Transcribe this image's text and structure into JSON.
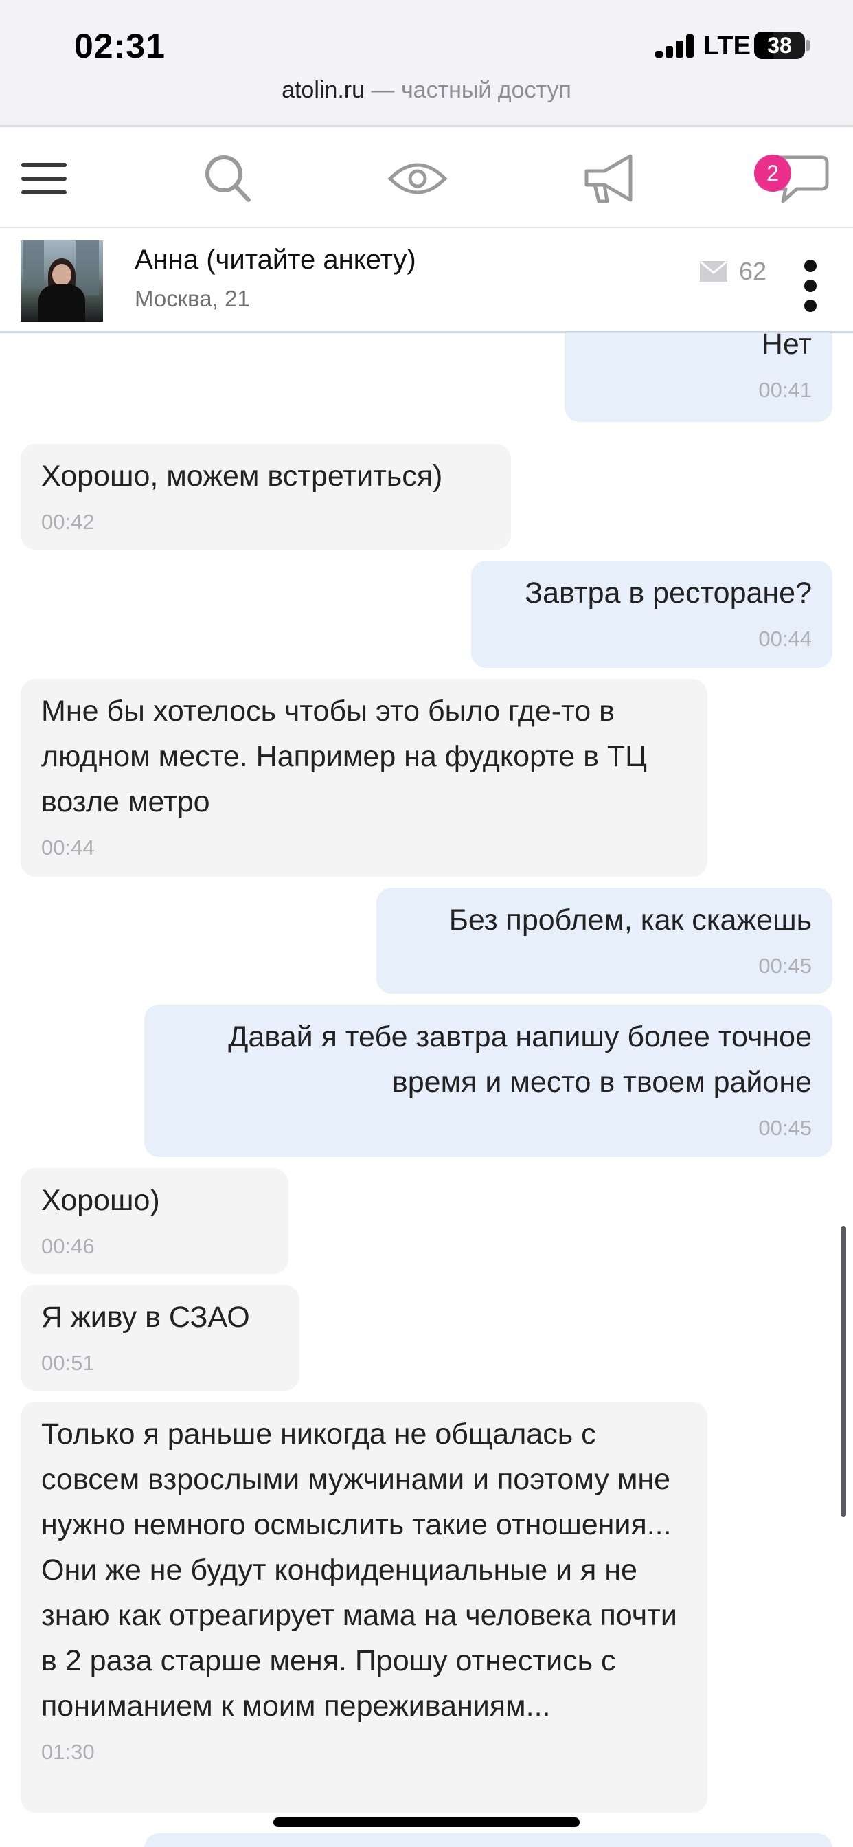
{
  "status_bar": {
    "time": "02:31",
    "network": "LTE",
    "battery": "38"
  },
  "url_bar": {
    "domain": "atolin.ru",
    "separator": "—",
    "access": "частный доступ"
  },
  "nav": {
    "items": [
      "menu-icon",
      "search-icon",
      "eye-icon",
      "megaphone-icon",
      "chat-icon"
    ],
    "chat_badge": "2",
    "accent_color": "#ea2f8d"
  },
  "chat_header": {
    "name": "Анна (читайте анкету)",
    "location": "Москва, 21",
    "message_count": "62"
  },
  "messages": [
    {
      "direction": "out",
      "text": "Нет",
      "time": "00:41"
    },
    {
      "direction": "in",
      "text": "Хорошо, можем встретиться)",
      "time": "00:42"
    },
    {
      "direction": "out",
      "text": "Завтра в ресторане?",
      "time": "00:44"
    },
    {
      "direction": "in",
      "text": "Мне бы хотелось чтобы это было где-то в людном месте. Например на фудкорте в ТЦ возле метро",
      "time": "00:44"
    },
    {
      "direction": "out",
      "text": "Без проблем, как скажешь",
      "time": "00:45"
    },
    {
      "direction": "out",
      "text": "Давай я тебе завтра напишу более точное время и место в твоем районе",
      "time": "00:45"
    },
    {
      "direction": "in",
      "text": "Хорошо)",
      "time": "00:46"
    },
    {
      "direction": "in",
      "text": "Я живу в СЗАО",
      "time": "00:51"
    },
    {
      "direction": "in",
      "text": "Только я раньше никогда не общалась с совсем взрослыми мужчинами и поэтому мне нужно немного осмыслить такие отношения... Они же не будут конфиденциальные и я не знаю как отреагирует мама на человека почти в 2 раза старше меня. Прошу отнестись с пониманием к моим переживаниям...",
      "time": "01:30"
    }
  ]
}
